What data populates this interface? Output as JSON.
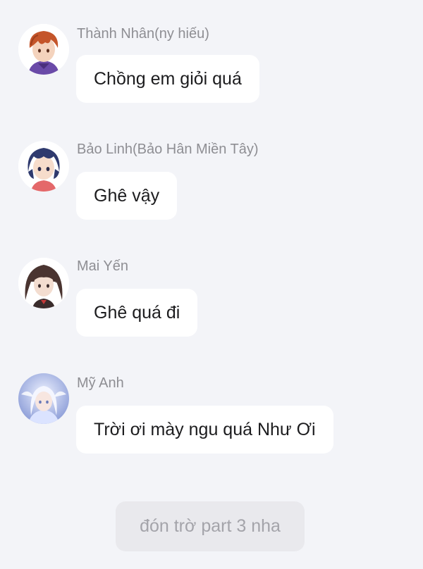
{
  "messages": [
    {
      "sender": "Thành Nhân(ny hiếu)",
      "text": "Chồng em giỏi quá",
      "avatar_icon": "red-haired-boy-avatar"
    },
    {
      "sender": "Bảo Linh(Bảo Hân Miền Tây)",
      "text": "Ghê vậy",
      "avatar_icon": "blue-haired-girl-avatar"
    },
    {
      "sender": "Mai Yến",
      "text": "Ghê quá đi",
      "avatar_icon": "brown-haired-girl-avatar"
    },
    {
      "sender": "Mỹ Anh",
      "text": "Trời ơi mày ngu quá Như  Ơi",
      "avatar_icon": "white-haired-angel-avatar"
    }
  ],
  "footer": {
    "text": "đón trờ part 3 nha"
  },
  "colors": {
    "background": "#f3f4f8",
    "bubble": "#ffffff",
    "sender_text": "#8e8e93",
    "message_text": "#1c1c1e",
    "footer_pill": "#e9e9ed",
    "footer_text": "#a4a4aa"
  }
}
